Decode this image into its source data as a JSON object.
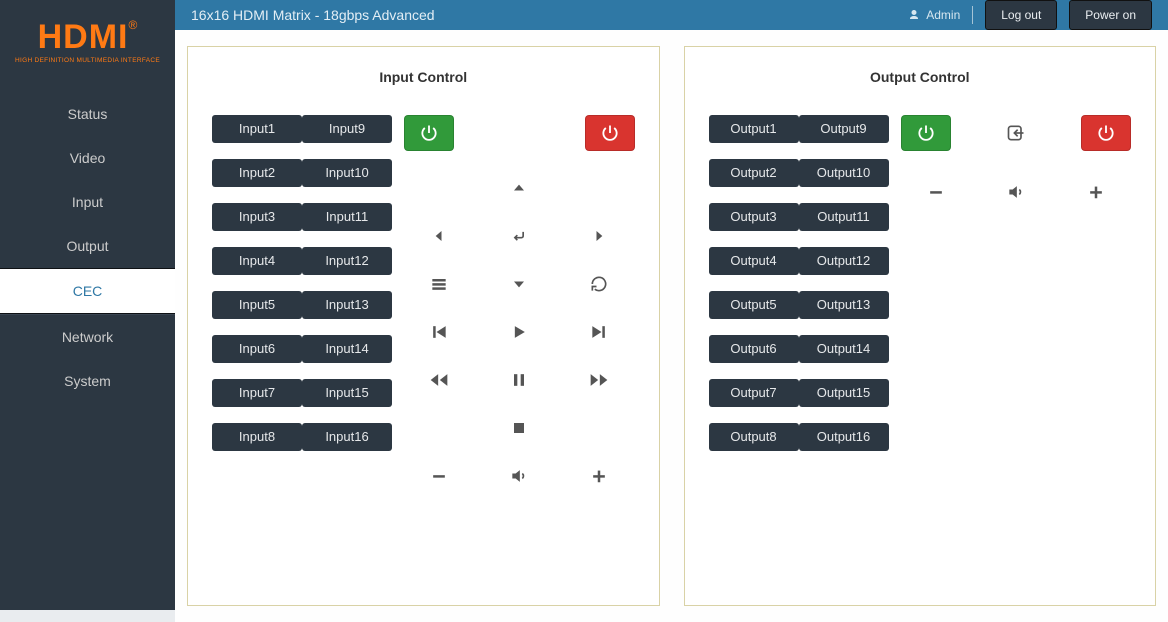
{
  "header": {
    "title": "16x16 HDMI Matrix - 18gbps Advanced",
    "admin_label": "Admin",
    "logout": "Log out",
    "poweron": "Power on"
  },
  "logo": {
    "word": "HDMI",
    "reg": "®",
    "sub": "HIGH DEFINITION MULTIMEDIA INTERFACE"
  },
  "nav": {
    "status": "Status",
    "video": "Video",
    "input": "Input",
    "output": "Output",
    "cec": "CEC",
    "network": "Network",
    "system": "System"
  },
  "input_panel": {
    "title": "Input Control",
    "pairs": [
      [
        "Input1",
        "Input9"
      ],
      [
        "Input2",
        "Input10"
      ],
      [
        "Input3",
        "Input11"
      ],
      [
        "Input4",
        "Input12"
      ],
      [
        "Input5",
        "Input13"
      ],
      [
        "Input6",
        "Input14"
      ],
      [
        "Input7",
        "Input15"
      ],
      [
        "Input8",
        "Input16"
      ]
    ]
  },
  "output_panel": {
    "title": "Output Control",
    "pairs": [
      [
        "Output1",
        "Output9"
      ],
      [
        "Output2",
        "Output10"
      ],
      [
        "Output3",
        "Output11"
      ],
      [
        "Output4",
        "Output12"
      ],
      [
        "Output5",
        "Output13"
      ],
      [
        "Output6",
        "Output14"
      ],
      [
        "Output7",
        "Output15"
      ],
      [
        "Output8",
        "Output16"
      ]
    ]
  }
}
